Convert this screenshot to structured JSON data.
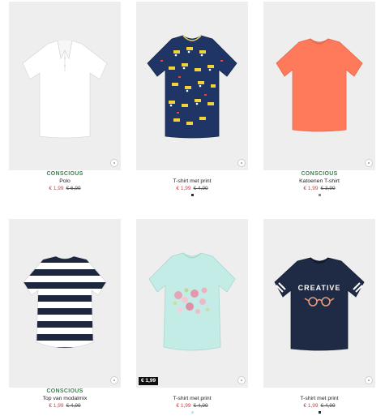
{
  "products": [
    {
      "badge": "CONSCIOUS",
      "title": "Polo",
      "price": "€ 1,99",
      "old_price": "€ 6,99",
      "swatch": "#ffffff",
      "sale_tag": ""
    },
    {
      "badge": "",
      "title": "T-shirt met print",
      "price": "€ 1,99",
      "old_price": "€ 4,99",
      "swatch": "#2a2f3a",
      "sale_tag": ""
    },
    {
      "badge": "CONSCIOUS",
      "title": "Katoenen T-shirt",
      "price": "€ 1,99",
      "old_price": "€ 3,99",
      "swatch": "#ff7a5a",
      "sale_tag": ""
    },
    {
      "badge": "CONSCIOUS",
      "title": "Top van modalmix",
      "price": "€ 1,99",
      "old_price": "€ 4,99",
      "swatch": "",
      "sale_tag": ""
    },
    {
      "badge": "",
      "title": "T-shirt met print",
      "price": "€ 1,99",
      "old_price": "€ 4,99",
      "swatch": "#bfe9e2",
      "sale_tag": "€ 1,99"
    },
    {
      "badge": "",
      "title": "T-shirt met print",
      "price": "€ 1,99",
      "old_price": "€ 4,99",
      "swatch": "#1f2a44",
      "sale_tag": ""
    }
  ],
  "print_text": "CREATIVE"
}
